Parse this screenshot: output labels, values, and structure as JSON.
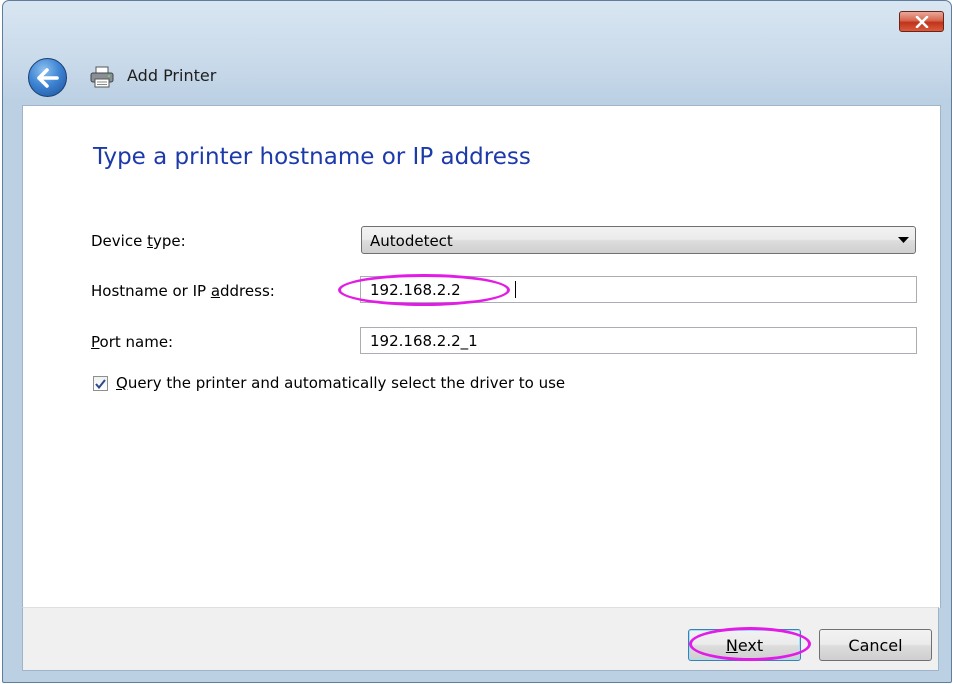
{
  "window": {
    "title": "Add Printer"
  },
  "main": {
    "heading": "Type a printer hostname or IP address",
    "device_type": {
      "label_pre": "Device ",
      "label_accel": "t",
      "label_post": "ype:",
      "value": "Autodetect"
    },
    "hostname": {
      "label_pre": "Hostname or IP ",
      "label_accel": "a",
      "label_post": "ddress:",
      "value": "192.168.2.2"
    },
    "port": {
      "label_pre": "",
      "label_accel": "P",
      "label_post": "ort name:",
      "value": "192.168.2.2_1"
    },
    "query": {
      "checked": true,
      "label_pre": "",
      "label_accel": "Q",
      "label_post": "uery the printer and automatically select the driver to use"
    }
  },
  "footer": {
    "next_pre": "",
    "next_accel": "N",
    "next_post": "ext",
    "cancel_label": "Cancel"
  },
  "colors": {
    "heading": "#1c3aa9",
    "highlight": "#e21ce6",
    "close_button": "#c1331a"
  },
  "icons": [
    "close-icon",
    "back-arrow-icon",
    "printer-icon",
    "dropdown-arrow-icon",
    "checkmark-icon"
  ]
}
